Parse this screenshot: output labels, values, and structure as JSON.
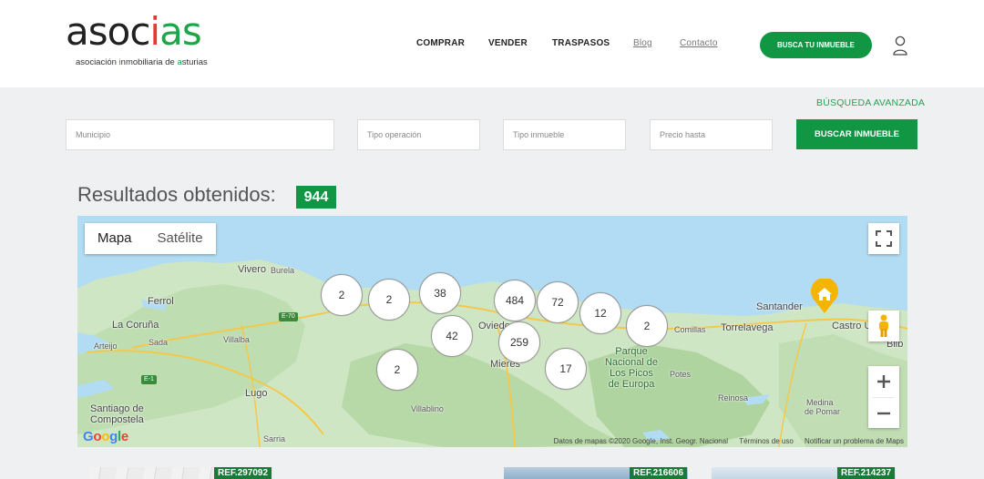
{
  "header": {
    "logo": {
      "word_black_1": "as",
      "word_black_2": "oc",
      "word_red": "i",
      "word_green": "as",
      "tagline_1": "asociación ",
      "tagline_2": "i",
      "tagline_3": "nmobiliaria de ",
      "tagline_4": "a",
      "tagline_5": "sturias"
    },
    "nav": [
      "COMPRAR",
      "VENDER",
      "TRASPASOS",
      "Blog",
      "Contacto"
    ],
    "cta_label": "BUSCA TU INMUEBLE",
    "user_icon": "user-icon"
  },
  "search": {
    "advanced_link": "BÚSQUEDA AVANZADA",
    "municipio_placeholder": "Municipio",
    "operacion_placeholder": "Tipo operación",
    "inmueble_placeholder": "Tipo inmueble",
    "precio_placeholder": "Precio hasta",
    "button_label": "BUSCAR INMUEBLE"
  },
  "results": {
    "title": "Resultados obtenidos:",
    "count": "944"
  },
  "map": {
    "type_buttons": [
      "Mapa",
      "Satélite"
    ],
    "active_type": "Mapa",
    "clusters": [
      "2",
      "2",
      "38",
      "484",
      "72",
      "12",
      "2",
      "42",
      "259",
      "2",
      "17"
    ],
    "places": [
      "Vivero",
      "Burela",
      "Ferrol",
      "La Coruña",
      "Sada",
      "Arteijo",
      "Villalba",
      "Lugo",
      "Santiago de",
      "Compostela",
      "Sarria",
      "Oviedo",
      "Mieres",
      "Villablino",
      "Parque",
      "Nacional de",
      "Los Picos",
      "de Europa",
      "Potes",
      "Comillas",
      "Torrelavega",
      "Santander",
      "Castro U",
      "Bilb",
      "Reinosa",
      "Medina",
      "de Pomar"
    ],
    "roads": [
      "E-70",
      "E-1"
    ],
    "google_logo": "Google",
    "attribution": [
      "Datos de mapas ©2020 Google, Inst. Geogr. Nacional",
      "Términos de uso",
      "Notificar un problema de Maps"
    ],
    "controls": [
      "fullscreen-icon",
      "pegman-icon",
      "zoom-in-icon",
      "zoom-out-icon"
    ],
    "home_marker": "home-icon"
  },
  "cards": [
    {
      "ref": "REF.297092"
    },
    {
      "ref": "REF.216606"
    },
    {
      "ref": "REF.214237"
    }
  ],
  "colors": {
    "brand_green": "#119744",
    "link_green": "#27a257",
    "logo_red": "#e53935",
    "logo_green": "#1ea548",
    "marker_yellow": "#f5b400"
  }
}
